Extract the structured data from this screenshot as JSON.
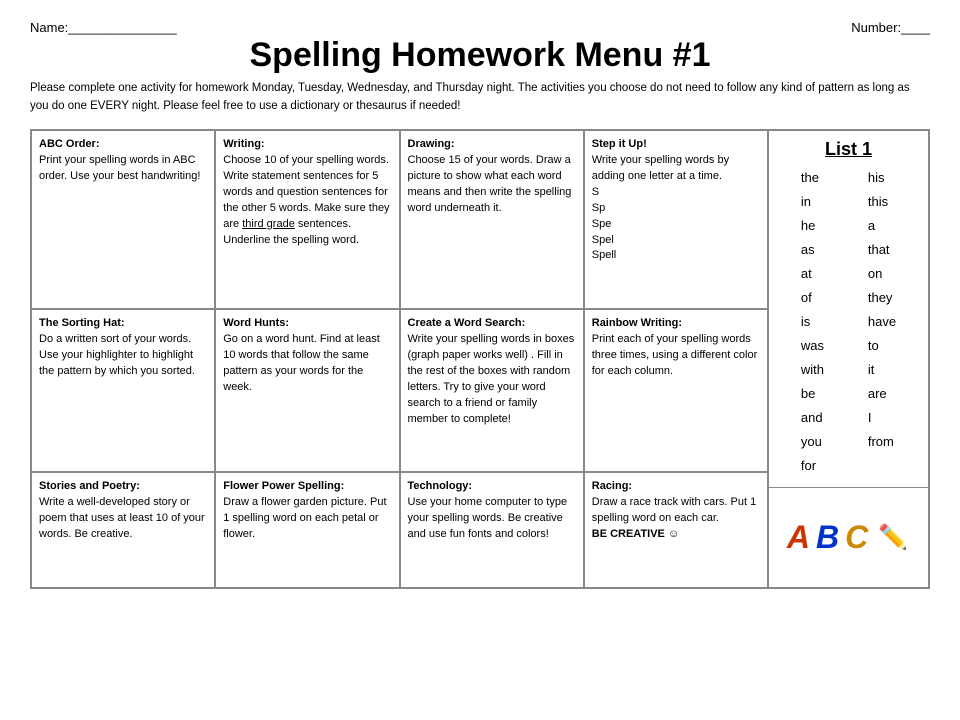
{
  "header": {
    "name_label": "Name:_______________",
    "number_label": "Number:____",
    "title": "Spelling Homework Menu #1",
    "instructions": "Please complete one activity for homework Monday, Tuesday, Wednesday, and Thursday night.   The activities you choose do not need to follow any kind of pattern as long as you do one EVERY night.  Please feel free to use a dictionary or thesaurus if needed!"
  },
  "grid": {
    "rows": [
      [
        {
          "title": "ABC Order:",
          "body": "Print your spelling words in ABC order.  Use your best handwriting!"
        },
        {
          "title": "Writing:",
          "body": "Choose 10 of your spelling words.  Write statement sentences for 5 words and question sentences for the other 5 words.  Make sure they are third grade sentences. Underline the spelling word."
        },
        {
          "title": "Drawing:",
          "body": "Choose 15 of your words.  Draw a picture to show what each word means and then write the spelling word underneath it."
        },
        {
          "title": "Step it Up!",
          "body": "Write your spelling words by adding one letter at a time.\nS\nSp\nSpe\nSpel\nSpell"
        }
      ],
      [
        {
          "title": "The Sorting Hat:",
          "body": "Do a written sort of your words.  Use your highlighter to highlight the pattern by which you sorted."
        },
        {
          "title": "Word Hunts:",
          "body": "Go on a word hunt.  Find at least 10 words that follow the same pattern as your words for the week."
        },
        {
          "title": "Create a Word Search:",
          "body": "Write your spelling words in boxes (graph paper works well) . Fill in the rest of the boxes with random letters. Try to give your word search to a friend or family member to complete!"
        },
        {
          "title": "Rainbow Writing:",
          "body": "Print each of your spelling words three times, using a different color for each column."
        }
      ],
      [
        {
          "title": "Stories and Poetry:",
          "body": "Write a well-developed story or poem that uses at least 10 of your words.  Be creative."
        },
        {
          "title": "Flower Power Spelling:",
          "body": "Draw a flower garden picture.  Put 1 spelling word on each petal or flower."
        },
        {
          "title": "Technology:",
          "body": "Use your home computer to type your spelling words.  Be creative and use fun fonts and colors!"
        },
        {
          "title": "Racing:",
          "body": "Draw a race track with cars.  Put 1 spelling word on each car.\nBE CREATIVE 😊"
        }
      ]
    ]
  },
  "sidebar": {
    "list_title": "List 1",
    "col1": [
      "the",
      "in",
      "he",
      "as",
      "at",
      "of",
      "is",
      "was",
      "with",
      "be",
      "and",
      "you",
      "for"
    ],
    "col2": [
      "his",
      "this",
      "a",
      "that",
      "on",
      "they",
      "have",
      "to",
      "it",
      "are",
      "I",
      "from"
    ],
    "abc_letters": [
      "A",
      "B",
      "C"
    ]
  }
}
